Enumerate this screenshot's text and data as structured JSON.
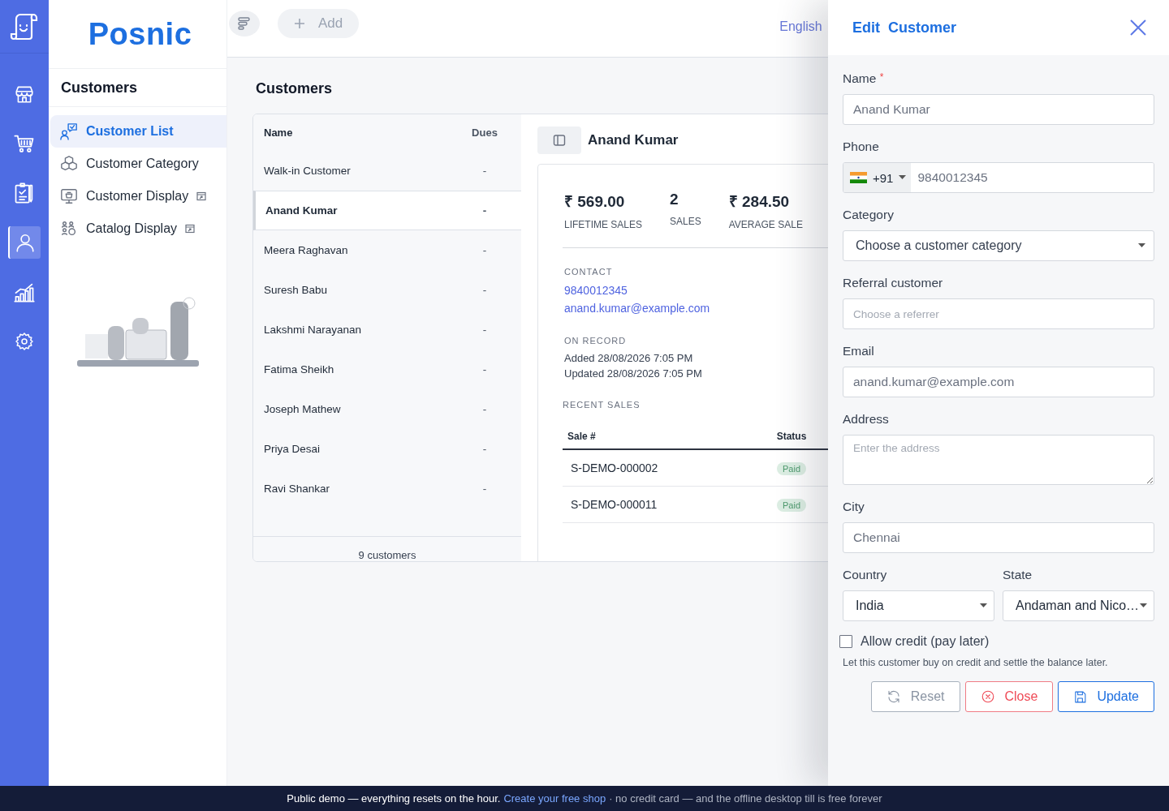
{
  "rail": {
    "items": [
      {
        "selected": false
      },
      {
        "selected": false
      },
      {
        "selected": false
      },
      {
        "selected": true
      },
      {
        "selected": false
      },
      {
        "selected": false
      }
    ]
  },
  "brand": "Posnic",
  "sidebar": {
    "title": "Customers",
    "items": [
      {
        "label": "Customer List",
        "selected": true,
        "external": false
      },
      {
        "label": "Customer Category",
        "selected": false,
        "external": false
      },
      {
        "label": "Customer Display",
        "selected": false,
        "external": true
      },
      {
        "label": "Catalog Display",
        "selected": false,
        "external": true
      }
    ]
  },
  "toolbar": {
    "add_label": "Add",
    "language": "English"
  },
  "page_title": "Customers",
  "customer_table": {
    "columns": [
      "Name",
      "Dues"
    ],
    "rows": [
      {
        "name": "Walk-in Customer",
        "dues": "-",
        "selected": false
      },
      {
        "name": "Anand Kumar",
        "dues": "-",
        "selected": true
      },
      {
        "name": "Meera Raghavan",
        "dues": "-",
        "selected": false
      },
      {
        "name": "Suresh Babu",
        "dues": "-",
        "selected": false
      },
      {
        "name": "Lakshmi Narayanan",
        "dues": "-",
        "selected": false
      },
      {
        "name": "Fatima Sheikh",
        "dues": "-",
        "selected": false
      },
      {
        "name": "Joseph Mathew",
        "dues": "-",
        "selected": false
      },
      {
        "name": "Priya Desai",
        "dues": "-",
        "selected": false
      },
      {
        "name": "Ravi Shankar",
        "dues": "-",
        "selected": false
      }
    ],
    "footer": "9 customers"
  },
  "detail": {
    "name": "Anand Kumar",
    "stats": [
      {
        "value": "₹ 569.00",
        "label": "LIFETIME SALES"
      },
      {
        "value": "2",
        "label": "SALES"
      },
      {
        "value": "₹ 284.50",
        "label": "AVERAGE SALE"
      }
    ],
    "contact": {
      "label": "CONTACT",
      "phone": "9840012345",
      "email": "anand.kumar@example.com"
    },
    "record": {
      "label": "ON RECORD",
      "lines": [
        "Added 28/08/2026 7:05 PM",
        "Updated 28/08/2026 7:05 PM"
      ]
    },
    "recent_sales": {
      "label": "RECENT SALES",
      "columns": [
        "Sale #",
        "Status"
      ],
      "rows": [
        {
          "number": "S-DEMO-000002",
          "status": "Paid"
        },
        {
          "number": "S-DEMO-000011",
          "status": "Paid"
        }
      ]
    }
  },
  "drawer": {
    "title": "Edit  Customer",
    "fields": [
      {
        "kind": "text",
        "label": "Name",
        "required_mark": "*",
        "value": "Anand Kumar"
      },
      {
        "kind": "phone",
        "label": "Phone",
        "country_code": "+91",
        "value": "9840012345"
      },
      {
        "kind": "select",
        "label": "Category",
        "value": "Choose a customer category"
      },
      {
        "kind": "text",
        "label": "Referral customer",
        "placeholder": "Choose a referrer"
      },
      {
        "kind": "text",
        "label": "Email",
        "value": "anand.kumar@example.com"
      },
      {
        "kind": "textarea",
        "label": "Address",
        "placeholder": "Enter the address"
      },
      {
        "kind": "text",
        "label": "City",
        "value": "Chennai"
      }
    ],
    "location": [
      {
        "label": "Country",
        "value": "India"
      },
      {
        "label": "State",
        "value": "Andaman and Nico…"
      }
    ],
    "credit": {
      "label": "Allow credit (pay later)",
      "checked": false,
      "hint": "Let this customer buy on credit and settle the balance later."
    },
    "buttons": [
      {
        "kind": "reset",
        "label": "Reset"
      },
      {
        "kind": "close",
        "label": "Close"
      },
      {
        "kind": "update",
        "label": "Update"
      }
    ]
  },
  "banner": {
    "text": "Public demo — everything resets on the hour.",
    "link": "Create your free shop",
    "rest": "· no credit card — and the offline desktop till is free forever"
  }
}
